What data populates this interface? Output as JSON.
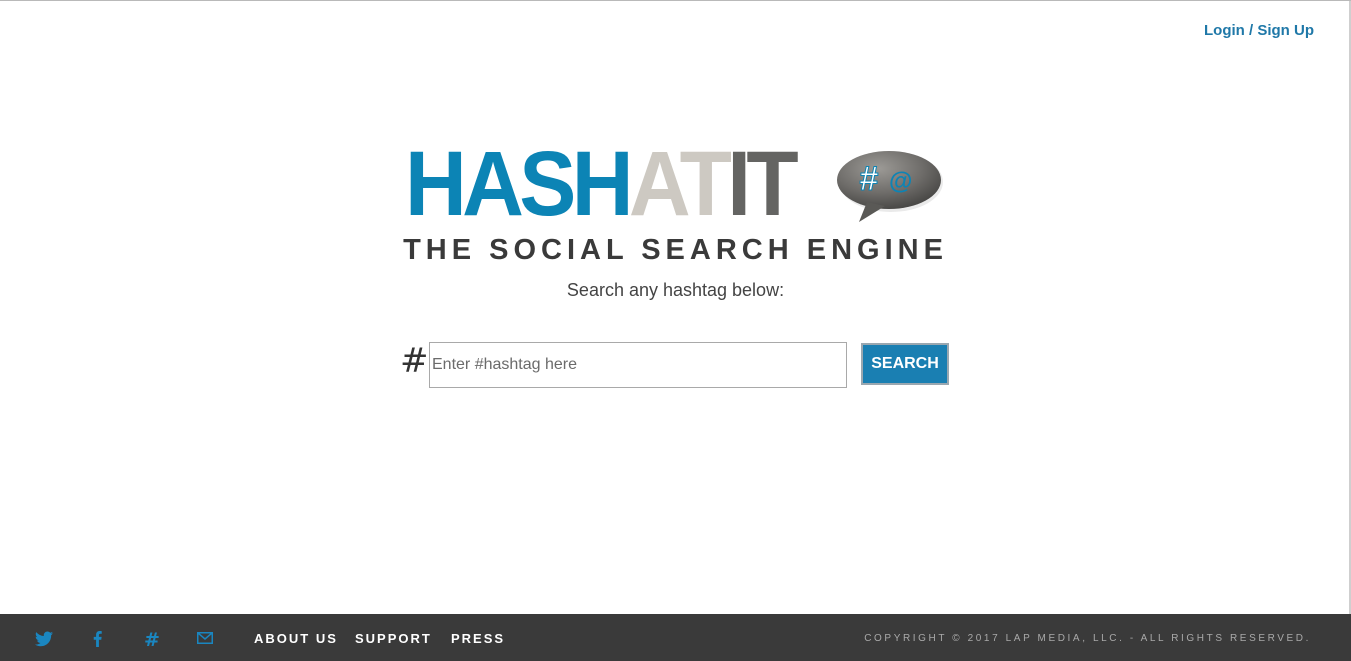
{
  "header": {
    "login_label": "Login / Sign Up"
  },
  "logo": {
    "part1": "HASH",
    "part2": "AT",
    "part3": "IT",
    "bubble_text_hash": "#",
    "bubble_text_at": "@"
  },
  "tagline": "THE SOCIAL SEARCH ENGINE",
  "subtitle": "Search any hashtag below:",
  "search": {
    "prefix": "#",
    "placeholder": "Enter #hashtag here",
    "value": "",
    "button_label": "SEARCH"
  },
  "footer": {
    "social_icons": [
      "twitter-icon",
      "facebook-icon",
      "hashtag-icon",
      "email-icon"
    ],
    "nav": [
      "ABOUT US",
      "SUPPORT",
      "PRESS"
    ],
    "copyright": "COPYRIGHT © 2017 LAP MEDIA, LLC. - ALL RIGHTS RESERVED."
  },
  "colors": {
    "brand_blue": "#0c84b5",
    "brand_light_gray": "#cdc9c2",
    "brand_dark_gray": "#646462",
    "footer_bg": "#3a3a3a",
    "link_blue": "#1f78a8"
  }
}
